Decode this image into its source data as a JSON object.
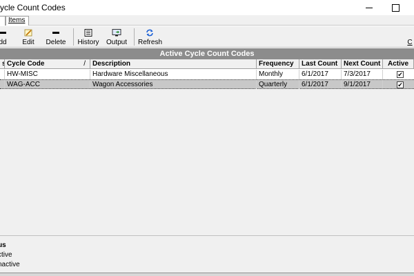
{
  "window": {
    "title": "ycle Count Codes"
  },
  "tabs": [
    {
      "label": ""
    },
    {
      "label": "Items"
    }
  ],
  "toolbar": {
    "add_label": "dd",
    "edit_label": "Edit",
    "delete_label": "Delete",
    "history_label": "History",
    "output_label": "Output",
    "refresh_label": "Refresh",
    "close_label": "C"
  },
  "grid": {
    "title": "Active Cycle Count Codes",
    "columns": [
      "s",
      "Cycle Code",
      "Description",
      "Frequency",
      "Last Count",
      "Next Count",
      "Active"
    ],
    "rows": [
      {
        "code": "HW-MISC",
        "description": "Hardware Miscellaneous",
        "frequency": "Monthly",
        "last_count": "6/1/2017",
        "next_count": "7/3/2017",
        "active": true
      },
      {
        "code": "WAG-ACC",
        "description": "Wagon Accessories",
        "frequency": "Quarterly",
        "last_count": "6/1/2017",
        "next_count": "9/1/2017",
        "active": true
      }
    ]
  },
  "legend": {
    "title": "us",
    "item1": "ctive",
    "item2": "nactive"
  },
  "icons": {
    "add": "minus-bar-icon",
    "edit": "pencil-icon",
    "delete": "minus-bar-icon",
    "history": "list-icon",
    "output": "monitor-arrow-icon",
    "refresh": "refresh-arrows-icon"
  },
  "colors": {
    "grid_title_bg": "#8c8c8c",
    "selected_row_bg": "#c8c8c8",
    "refresh_icon": "#1a5fd6"
  }
}
